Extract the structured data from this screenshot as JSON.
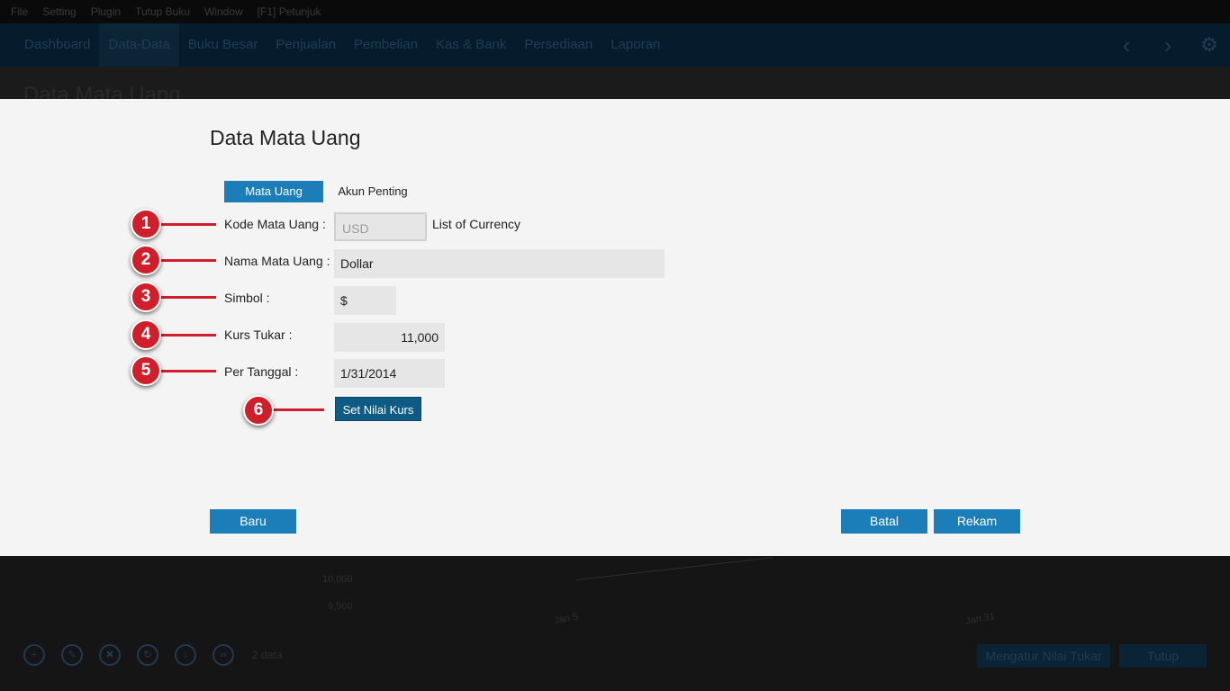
{
  "menu": [
    "File",
    "Setting",
    "Plugin",
    "Tutup Buku",
    "Window",
    "[F1] Petunjuk"
  ],
  "nav": [
    "Dashboard",
    "Data-Data",
    "Buku Besar",
    "Penjualan",
    "Pembelian",
    "Kas & Bank",
    "Persediaan",
    "Laporan"
  ],
  "nav_icons": [
    "chevron-left-icon",
    "chevron-right-icon",
    "gear-icon"
  ],
  "background": {
    "page_title": "Data Mata Uang",
    "chart_labels": [
      "10,000",
      "9,500",
      "Jan 5",
      "Jan 31"
    ],
    "record_count": "2 data",
    "buttons": [
      "Mengatur Nilai Tukar",
      "Tutup"
    ]
  },
  "dialog": {
    "title": "Data Mata Uang",
    "tabs": [
      "Mata Uang",
      "Akun Penting"
    ],
    "fields": {
      "kode": {
        "label": "Kode Mata Uang :",
        "value": "USD"
      },
      "nama": {
        "label": "Nama Mata Uang :",
        "value": "Dollar"
      },
      "simbol": {
        "label": "Simbol :",
        "value": "$"
      },
      "kurs": {
        "label": "Kurs Tukar :",
        "value": "11,000"
      },
      "tanggal": {
        "label": "Per Tanggal :",
        "value": "1/31/2014"
      }
    },
    "list_of_currency": "List of Currency",
    "set_nilai_kurs": "Set Nilai Kurs",
    "baru": "Baru",
    "batal": "Batal",
    "rekam": "Rekam"
  },
  "markers": [
    "1",
    "2",
    "3",
    "4",
    "5",
    "6"
  ],
  "colors": {
    "accent": "#1b7eb9",
    "accent_dark": "#0e5b86",
    "marker": "#d01f2a",
    "dialog_bg": "#f4f4f4",
    "field_bg": "#e6e6e6"
  }
}
